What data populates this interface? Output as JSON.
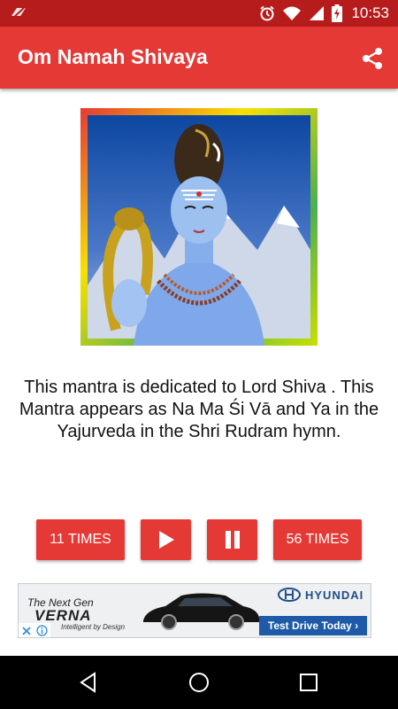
{
  "status_bar": {
    "time": "10:53"
  },
  "app_bar": {
    "title": "Om Namah Shivaya",
    "share_icon": "share-icon"
  },
  "main": {
    "image_alt": "Lord Shiva image",
    "description": "This mantra is dedicated to Lord Shiva . This Mantra appears as Na Ma Śi Vā and Ya in the Yajurveda in the Shri Rudram hymn."
  },
  "controls": {
    "times_11_label": "11 TIMES",
    "times_56_label": "56 TIMES",
    "play_icon": "play-icon",
    "pause_icon": "pause-icon"
  },
  "ad": {
    "headline": "The Next Gen",
    "model": "VERNA",
    "tagline": "Intelligent by Design",
    "brand": "HYUNDAI",
    "cta": "Test Drive Today ›"
  },
  "colors": {
    "accent": "#e53935",
    "status_bar": "#b71c1c",
    "ad_blue": "#1e5aa8"
  }
}
